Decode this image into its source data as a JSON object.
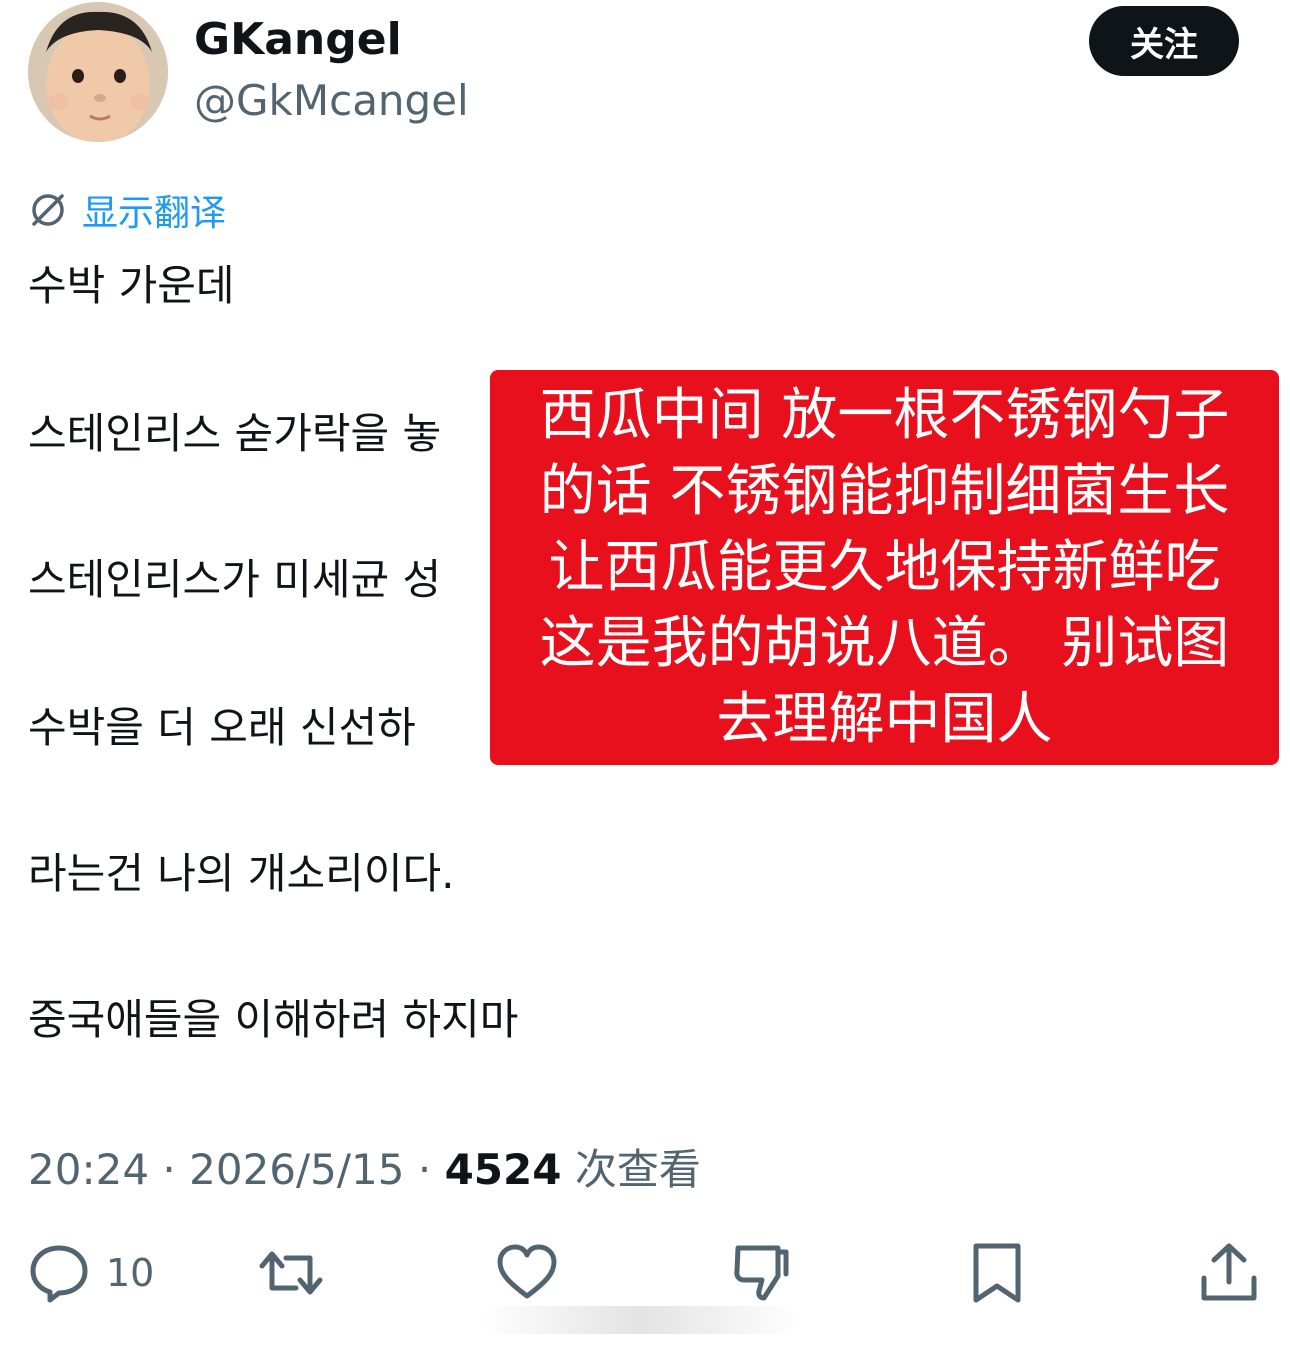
{
  "author": {
    "display_name": "GKangel",
    "handle": "@GkMcangel"
  },
  "follow_label": "关注",
  "translate_label": "显示翻译",
  "tweet_lines": [
    "수박 가운데",
    "스테인리스 숟가락을 놓",
    "스테인리스가 미세균 성",
    "수박을 더 오래 신선하",
    "라는건 나의 개소리이다.",
    "중국애들을 이해하려 하지마"
  ],
  "overlay_lines": [
    "西瓜中间 放一根不锈钢勺子",
    "的话 不锈钢能抑制细菌生长",
    "让西瓜能更久地保持新鲜吃",
    "这是我的胡说八道。 别试图",
    "去理解中国人"
  ],
  "meta": {
    "time": "20:24",
    "date": "2026/5/15",
    "separator": "·",
    "views": "4524",
    "views_label": "次查看"
  },
  "actions": {
    "reply_count": "10"
  },
  "colors": {
    "accent": "#1d9bf0",
    "overlay": "#e8101c",
    "secondary_text": "#536471"
  }
}
